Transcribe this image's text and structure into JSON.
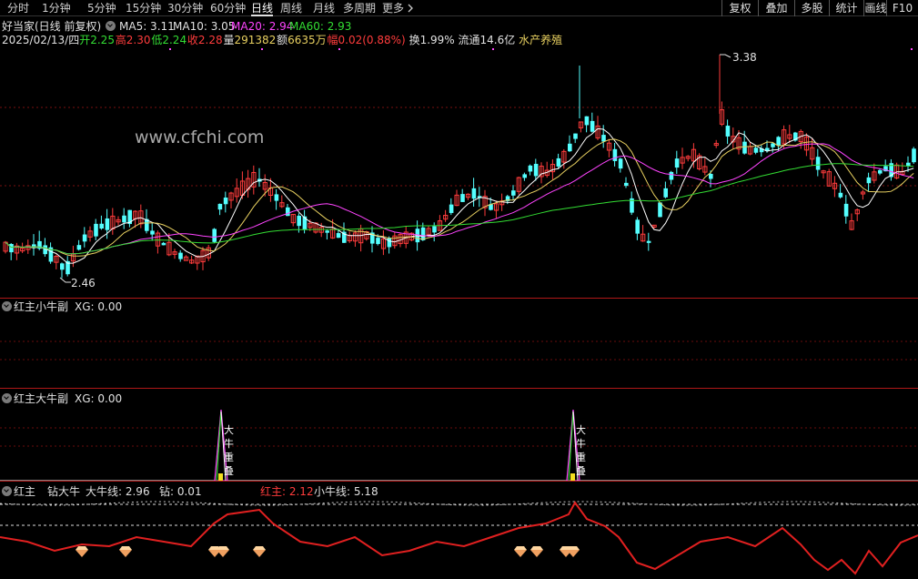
{
  "toolbar": {
    "periods": [
      "分时",
      "1分钟",
      "5分钟",
      "15分钟",
      "30分钟",
      "60分钟",
      "日线",
      "周线",
      "月线",
      "多周期",
      "更多"
    ],
    "active_period": "日线",
    "more_arrow": "chevron-right-icon",
    "right_buttons": [
      "复权",
      "叠加",
      "多股",
      "统计",
      "画线",
      "F10"
    ]
  },
  "main_panel": {
    "title": "好当家(日线 前复权)",
    "ma": [
      {
        "label": "MA5: 3.11",
        "color": "#ffffff"
      },
      {
        "label": "MA10: 3.05",
        "color": "#ffffff"
      },
      {
        "label": "MA20: 2.94",
        "color": "#ff44ff"
      },
      {
        "label": "MA60: 2.93",
        "color": "#33dd33"
      }
    ],
    "info": {
      "date": "2025/02/13/四",
      "open_label": "开",
      "open": "2.25",
      "high_label": "高",
      "high": "2.30",
      "low_label": "低",
      "low": "2.24",
      "close_label": "收",
      "close": "2.28",
      "volume_label": "量",
      "volume": "291382",
      "amount_label": "额",
      "amount": "6635万",
      "change_label": "幅",
      "change": "0.02(0.88%)",
      "turnover": "换1.99%",
      "float_cap": "流通14.6亿",
      "industry": "水产养殖"
    },
    "watermark": "www.cfchi.com",
    "high_marker": "3.38",
    "low_marker": "2.46"
  },
  "panel_small": {
    "title": "红主小牛副",
    "value": "XG: 0.00"
  },
  "panel_big": {
    "title": "红主大牛副",
    "value": "XG: 0.00",
    "signal_text": "大牛重叠"
  },
  "panel_red": {
    "title": "红主",
    "title_extra": "钻大牛",
    "bull_line": "大牛线: 2.96",
    "diamond": "钻: 0.01",
    "red_main": "红主: 2.12",
    "small_bull_line": "小牛线: 5.18"
  },
  "colors": {
    "up": "#ff3c3c",
    "down": "#54ffff",
    "red_line": "#e02020",
    "label_white": "#e0e0e0",
    "label_red": "#ff3c3c",
    "label_green": "#33dd33",
    "label_yellow": "#e8d060",
    "label_magenta": "#ff44ff",
    "separator": "#b01818",
    "diamond": "#f0a060"
  },
  "chart_data": {
    "type": "candlestick",
    "price_range": [
      2.46,
      3.38
    ],
    "high_label": "3.38",
    "low_label": "2.46",
    "series": [
      {
        "name": "MA5",
        "value": 3.11
      },
      {
        "name": "MA10",
        "value": 3.05
      },
      {
        "name": "MA20",
        "value": 2.94
      },
      {
        "name": "MA60",
        "value": 2.93
      }
    ],
    "big_bull_signals": 2,
    "diamond_signals": 9
  }
}
